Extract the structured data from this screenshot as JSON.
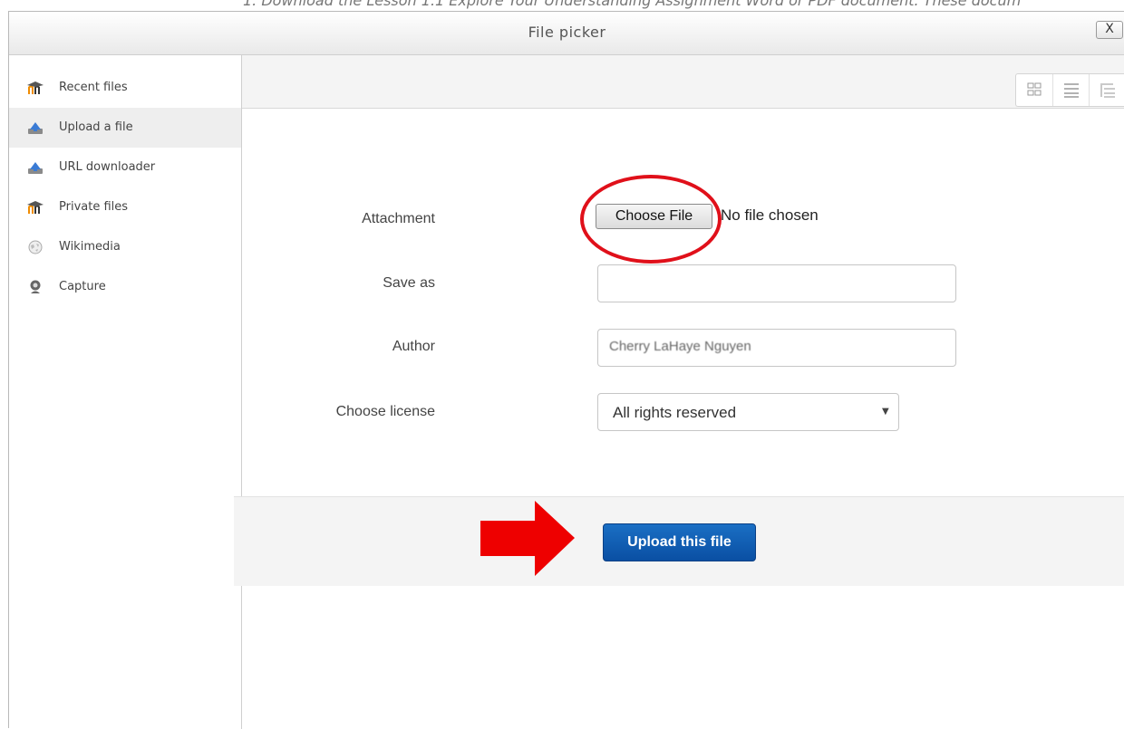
{
  "background_text": "1. Download the Lesson 1.1 Explore Your Understanding Assignment Word or PDF document. These docum",
  "dialog": {
    "title": "File picker",
    "close_label": "X"
  },
  "sidebar": {
    "items": [
      {
        "label": "Recent files",
        "icon": "moodle-icon"
      },
      {
        "label": "Upload a file",
        "icon": "upload-icon",
        "active": true
      },
      {
        "label": "URL downloader",
        "icon": "url-download-icon"
      },
      {
        "label": "Private files",
        "icon": "moodle-icon"
      },
      {
        "label": "Wikimedia",
        "icon": "wikimedia-icon"
      },
      {
        "label": "Capture",
        "icon": "webcam-icon"
      }
    ]
  },
  "form": {
    "attachment_label": "Attachment",
    "choose_file_label": "Choose File",
    "no_file_text": "No file chosen",
    "save_as_label": "Save as",
    "save_as_value": "",
    "author_label": "Author",
    "author_value": "Cherry LaHaye Nguyen",
    "license_label": "Choose license",
    "license_value": "All rights reserved",
    "upload_button_label": "Upload this file"
  },
  "colors": {
    "highlight_circle": "#e0101a",
    "arrow": "#ee0000",
    "primary_button": "#0a4fa3"
  }
}
